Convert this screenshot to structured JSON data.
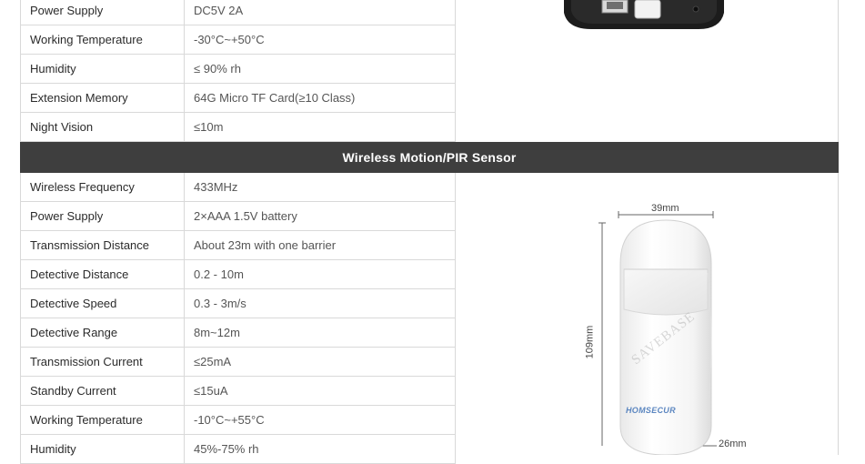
{
  "camera_specs": [
    {
      "label": "Power Supply",
      "value": "DC5V 2A"
    },
    {
      "label": "Working Temperature",
      "value": "-30°C~+50°C"
    },
    {
      "label": "Humidity",
      "value": "≤ 90% rh"
    },
    {
      "label": "Extension Memory",
      "value": "64G Micro TF Card(≥10 Class)"
    },
    {
      "label": "Night Vision",
      "value": "≤10m"
    }
  ],
  "section": {
    "title": "Wireless Motion/PIR Sensor"
  },
  "sensor_specs": [
    {
      "label": "Wireless Frequency",
      "value": "433MHz"
    },
    {
      "label": "Power Supply",
      "value": "2×AAA 1.5V battery"
    },
    {
      "label": "Transmission Distance",
      "value": "About 23m with one barrier"
    },
    {
      "label": "Detective Distance",
      "value": "0.2 - 10m"
    },
    {
      "label": "Detective Speed",
      "value": "0.3 - 3m/s"
    },
    {
      "label": "Detective Range",
      "value": "8m~12m"
    },
    {
      "label": "Transmission Current",
      "value": "≤25mA"
    },
    {
      "label": "Standby Current",
      "value": "≤15uA"
    },
    {
      "label": "Working Temperature",
      "value": "-10°C~+55°C"
    },
    {
      "label": "Humidity",
      "value": "45%-75% rh"
    }
  ],
  "sensor_image": {
    "width_label": "39mm",
    "height_label": "109mm",
    "depth_label": "26mm",
    "brand": "HOMSECUR",
    "watermark": "SAVEBASE"
  }
}
